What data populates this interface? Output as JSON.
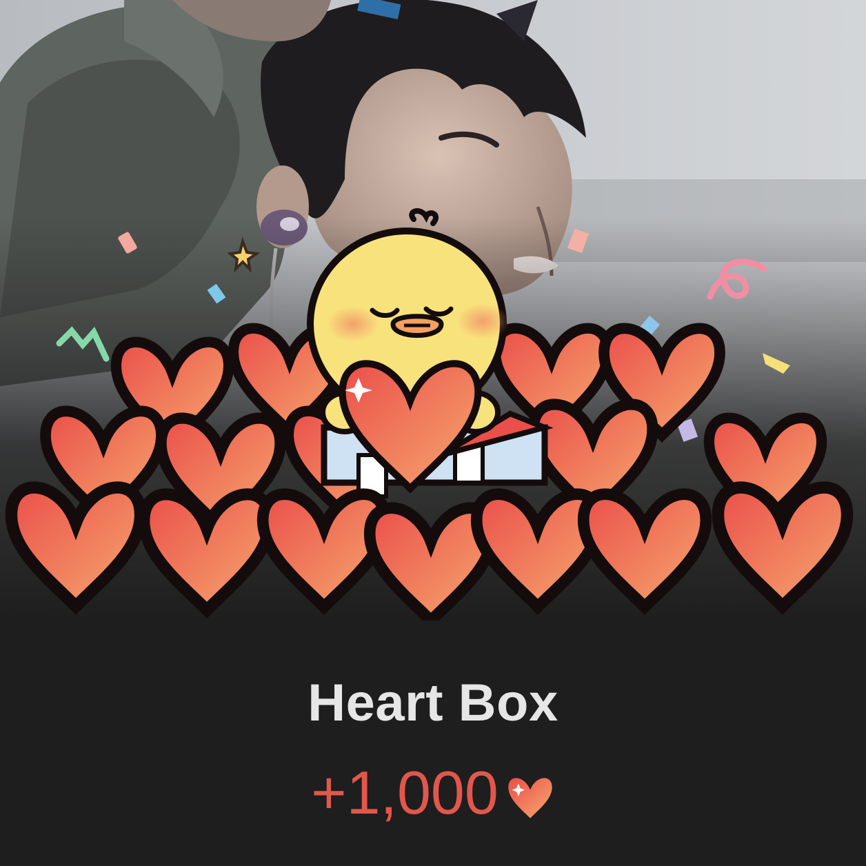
{
  "reward": {
    "title": "Heart Box",
    "amount": "+1,000"
  },
  "icons": {
    "reward_heart": "heart-icon",
    "character": "chick-character",
    "gift_box": "gift-box-icon"
  },
  "colors": {
    "background": "#1e1e1e",
    "title": "#e6e6e6",
    "amount": "#e2574c",
    "heart_light": "#f6a068",
    "heart_dark": "#ea4f4a",
    "chick": "#f8e27c"
  }
}
